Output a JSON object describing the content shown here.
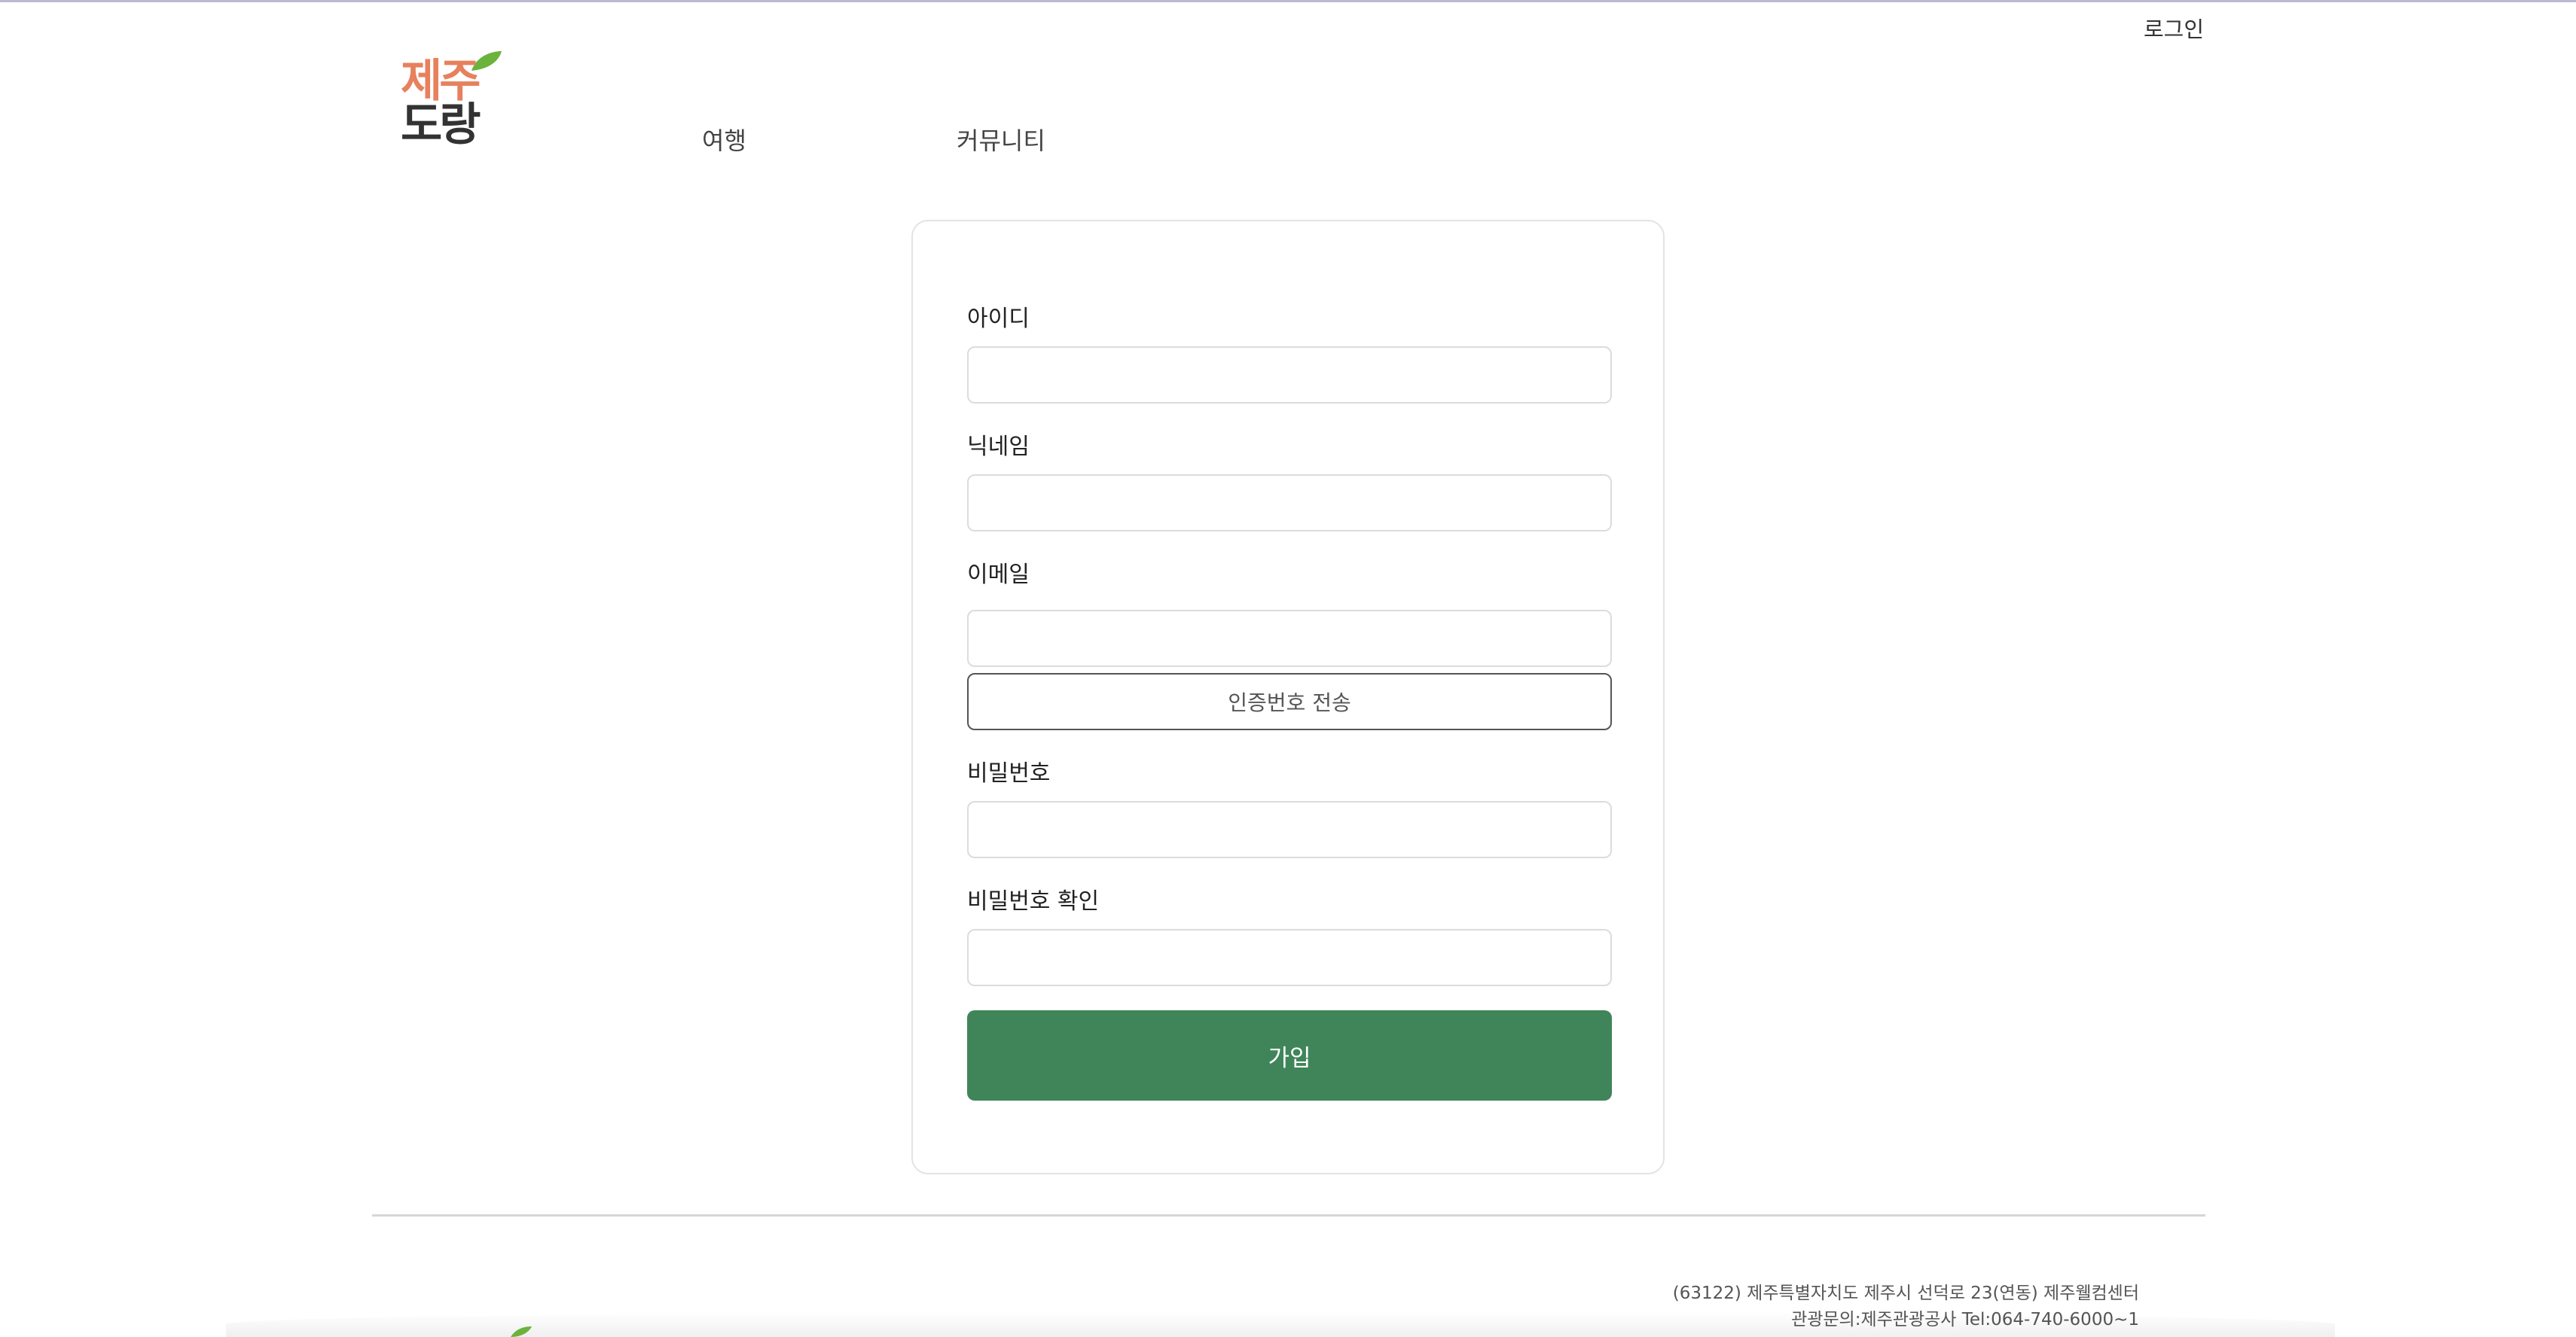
{
  "header": {
    "login_label": "로그인",
    "logo": {
      "line1": "제주",
      "line2": "도랑"
    },
    "nav": [
      {
        "label": "여행"
      },
      {
        "label": "커뮤니티"
      }
    ]
  },
  "signup_form": {
    "fields": {
      "id": {
        "label": "아이디",
        "value": "",
        "placeholder": ""
      },
      "nickname": {
        "label": "닉네임",
        "value": "",
        "placeholder": ""
      },
      "email": {
        "label": "이메일",
        "value": "",
        "placeholder": ""
      },
      "password": {
        "label": "비밀번호",
        "value": "",
        "placeholder": ""
      },
      "password_confirm": {
        "label": "비밀번호 확인",
        "value": "",
        "placeholder": ""
      }
    },
    "send_code_label": "인증번호 전송",
    "submit_label": "가입"
  },
  "footer": {
    "address": "(63122) 제주특별자치도 제주시 선덕로 23(연동) 제주웰컴센터",
    "contact": "관광문의:제주관광공사 Tel:064-740-6000~1"
  },
  "colors": {
    "primary_green": "#408559",
    "logo_orange": "#e7815d",
    "logo_dark": "#333333",
    "leaf_green": "#6bb33c"
  },
  "icons": {
    "logo_leaf": "leaf-icon"
  }
}
